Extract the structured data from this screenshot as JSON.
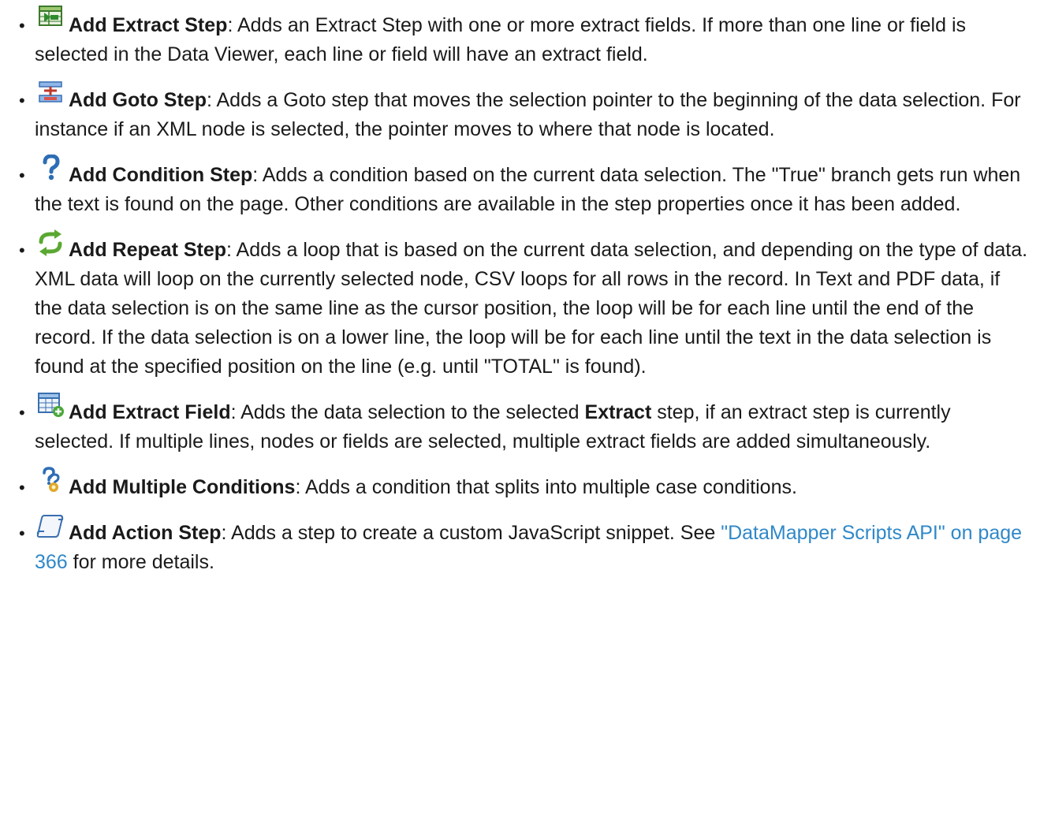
{
  "items": [
    {
      "icon": "extract-step-icon",
      "title": "Add Extract Step",
      "desc": ": Adds an Extract Step with one or more extract fields. If more than one line or field is selected in the Data Viewer, each line or field will have an extract field."
    },
    {
      "icon": "goto-step-icon",
      "title": "Add Goto Step",
      "desc": ": Adds a Goto step that moves the selection pointer to the beginning of the data selection. For instance if an XML node is selected, the pointer moves to where that node is located."
    },
    {
      "icon": "question-mark-icon",
      "title": "Add Condition Step",
      "desc": ": Adds a condition based on the current data selection. The \"True\" branch gets run when the text is found on the page. Other conditions are available in the step properties once it has been added."
    },
    {
      "icon": "repeat-arrows-icon",
      "title": "Add Repeat Step",
      "desc": ": Adds a loop that is based on the current data selection, and depending on the type of data. XML data  will loop on the currently selected node, CSV loops for all rows in the record. In Text and PDF data, if the data selection is on the same line as the cursor position, the loop will be for each line until the end of the record. If the data selection is on a lower line, the loop will be for each line until the text in the data selection is found at the specified position on the line (e.g. until \"TOTAL\" is found)."
    },
    {
      "icon": "extract-field-icon",
      "title": "Add Extract Field",
      "desc_before": ": Adds the data selection to the selected ",
      "bold_word": "Extract",
      "desc_after": " step, if an extract step is currently selected. If multiple lines, nodes or fields are selected, multiple extract fields are added simultaneously."
    },
    {
      "icon": "multiple-conditions-icon",
      "title": "Add Multiple Conditions",
      "desc": ": Adds a condition that splits into multiple case conditions."
    },
    {
      "icon": "action-scroll-icon",
      "title": "Add Action Step",
      "desc_before": ": Adds a step to create a custom JavaScript snippet. See ",
      "link_text": "\"DataMapper Scripts API\" on page 366",
      "desc_after": " for more details."
    }
  ],
  "bullet": "•",
  "colors": {
    "text": "#1a1a1a",
    "link": "#2f88c8"
  }
}
